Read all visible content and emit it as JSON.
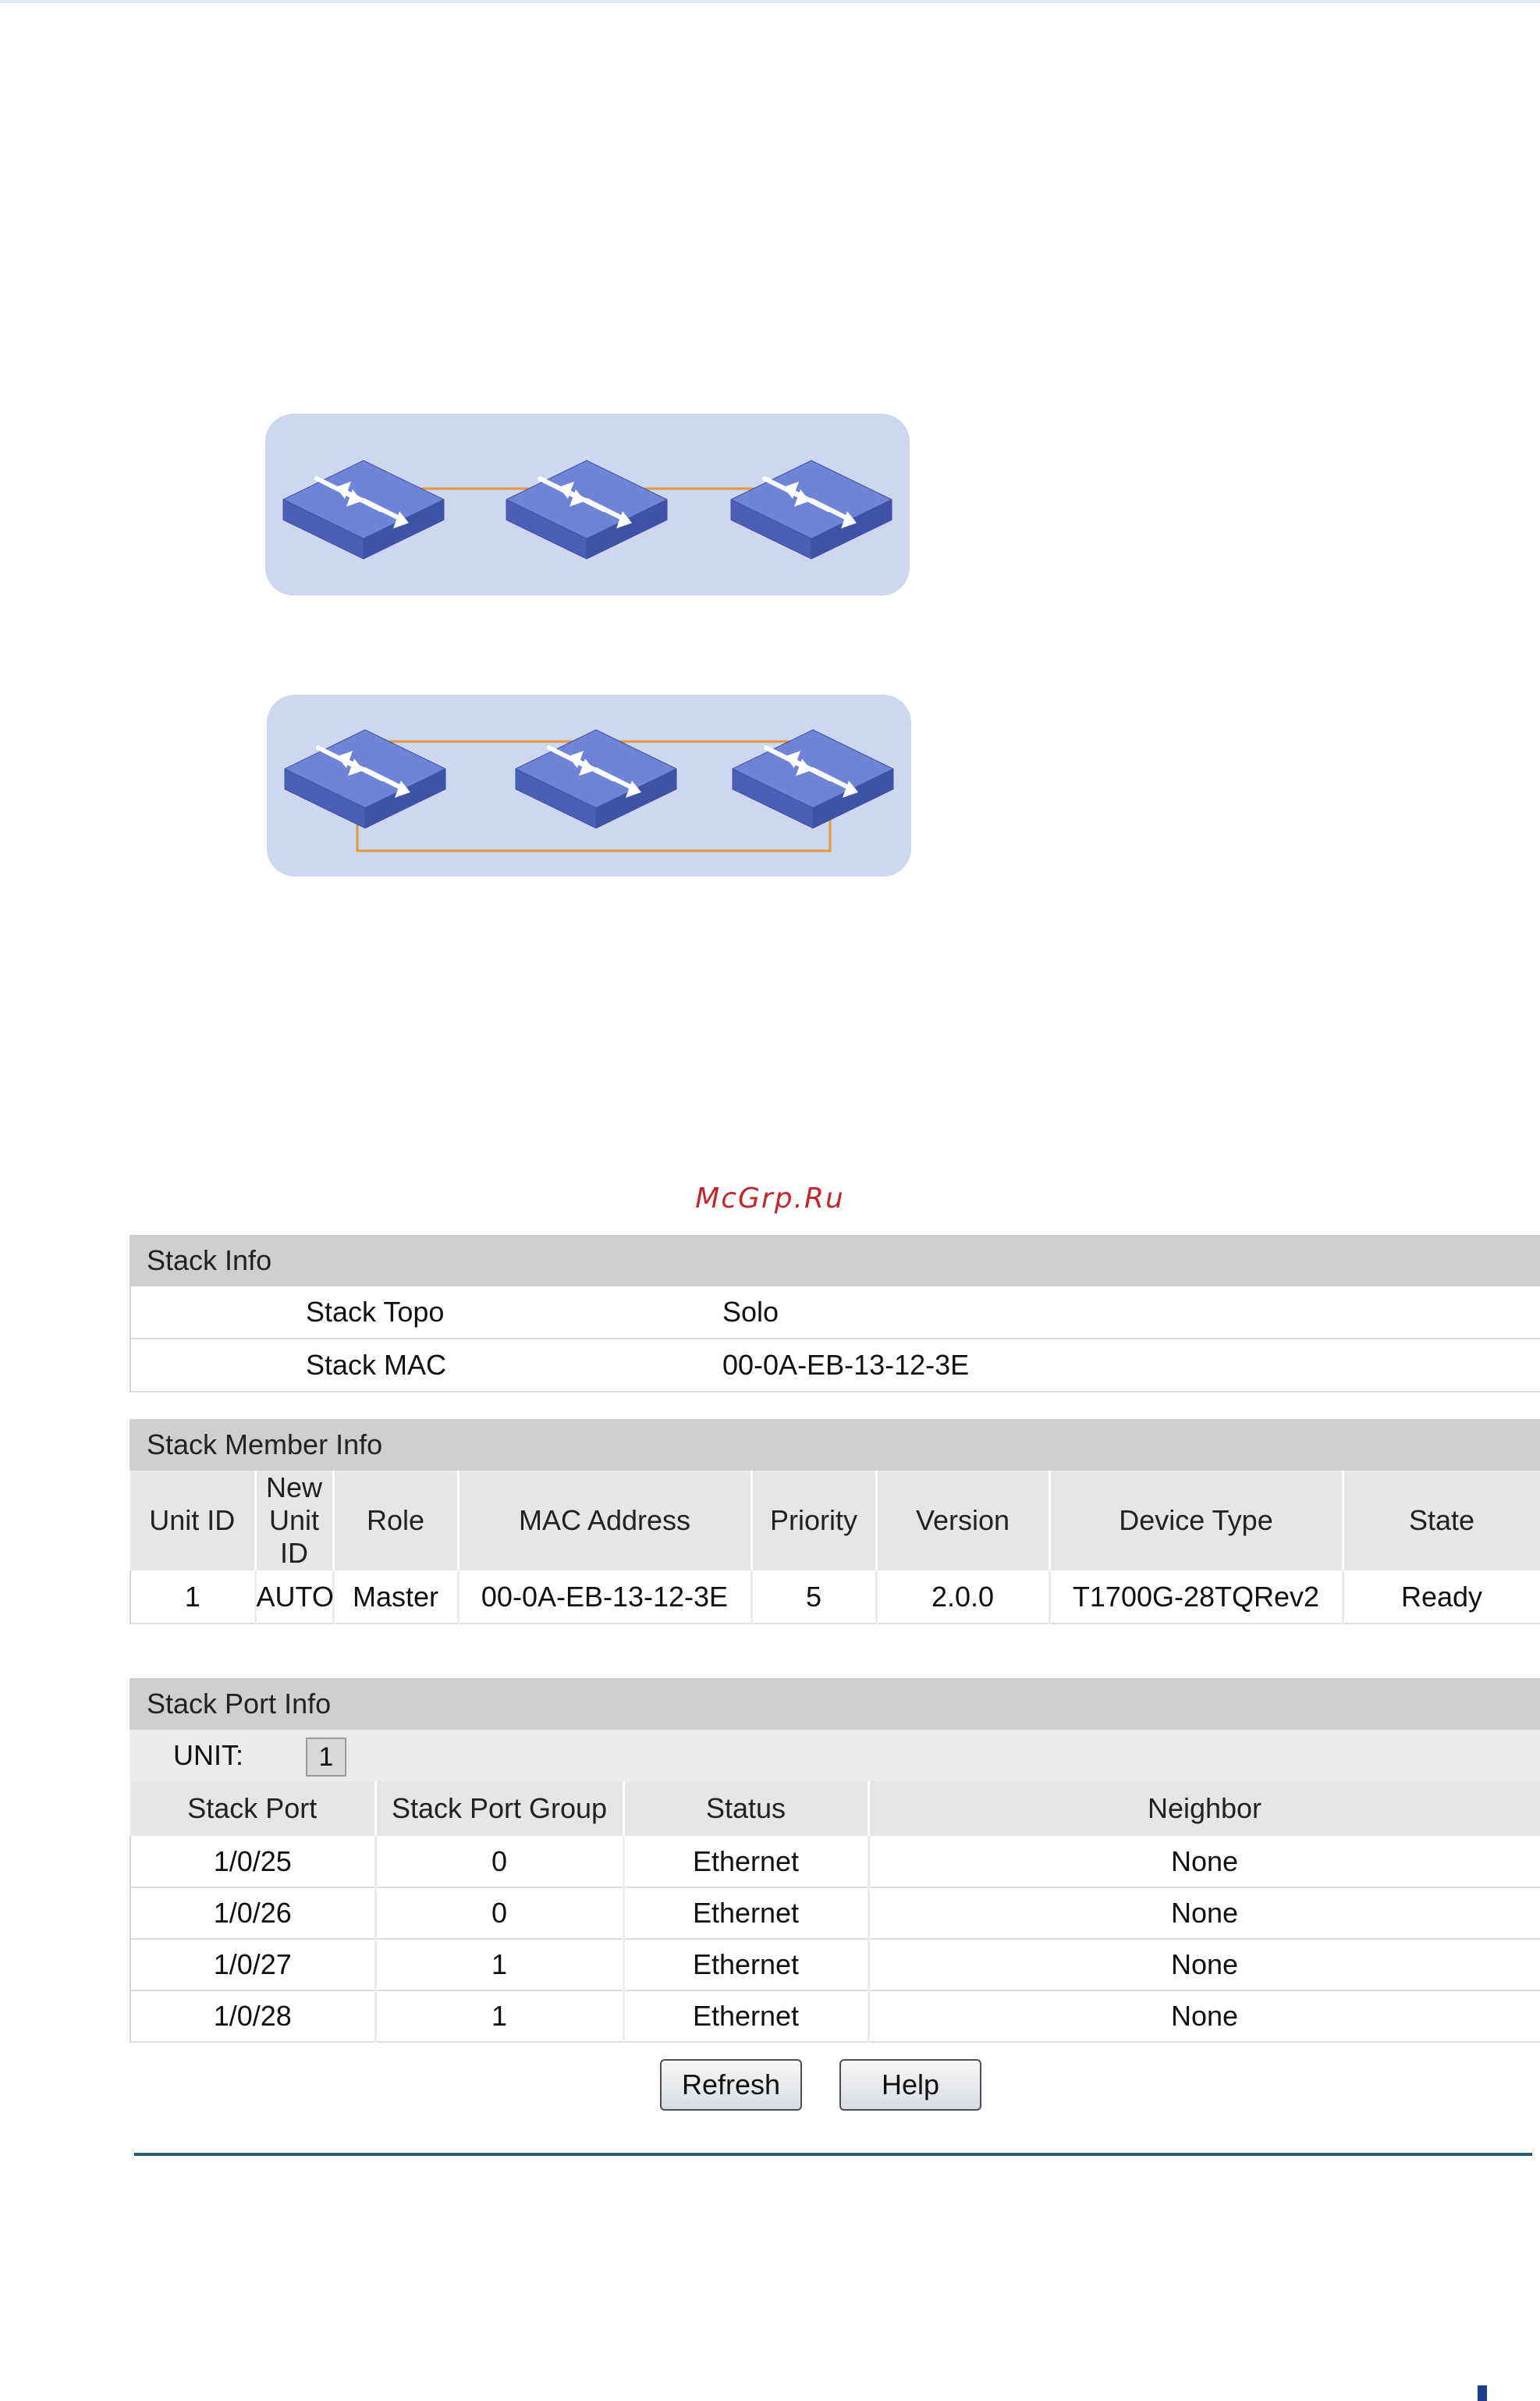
{
  "watermark": "McGrp.Ru",
  "stack_info": {
    "header": "Stack Info",
    "rows": [
      {
        "label": "Stack Topo",
        "value": "Solo"
      },
      {
        "label": "Stack MAC",
        "value": "00-0A-EB-13-12-3E"
      }
    ]
  },
  "stack_member_info": {
    "header": "Stack Member Info",
    "columns": [
      "Unit ID",
      "New Unit ID",
      "Role",
      "MAC Address",
      "Priority",
      "Version",
      "Device Type",
      "State"
    ],
    "rows": [
      [
        "1",
        "AUTO",
        "Master",
        "00-0A-EB-13-12-3E",
        "5",
        "2.0.0",
        "T1700G-28TQRev2",
        "Ready"
      ]
    ]
  },
  "stack_port_info": {
    "header": "Stack Port Info",
    "unit_label": "UNIT:",
    "unit_value": "1",
    "columns": [
      "Stack Port",
      "Stack Port Group",
      "Status",
      "Neighbor"
    ],
    "rows": [
      [
        "1/0/25",
        "0",
        "Ethernet",
        "None"
      ],
      [
        "1/0/26",
        "0",
        "Ethernet",
        "None"
      ],
      [
        "1/0/27",
        "1",
        "Ethernet",
        "None"
      ],
      [
        "1/0/28",
        "1",
        "Ethernet",
        "None"
      ]
    ]
  },
  "buttons": {
    "refresh": "Refresh",
    "help": "Help"
  },
  "colors": {
    "switch_top": "#6f84d6",
    "switch_side": "#4a5fb5",
    "link": "#e8963a",
    "panel": "#cdd8ef"
  },
  "icons": [
    "network-switch-icon"
  ]
}
